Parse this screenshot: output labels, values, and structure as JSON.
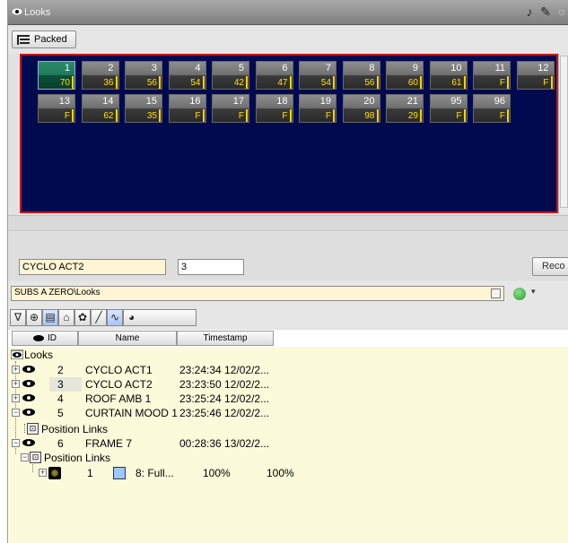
{
  "window": {
    "title": "Looks"
  },
  "toolbar": {
    "packed_label": "Packed"
  },
  "tiles": [
    {
      "num": "1",
      "val": "70",
      "selected": true
    },
    {
      "num": "2",
      "val": "36"
    },
    {
      "num": "3",
      "val": "56"
    },
    {
      "num": "4",
      "val": "54"
    },
    {
      "num": "5",
      "val": "42"
    },
    {
      "num": "6",
      "val": "47"
    },
    {
      "num": "7",
      "val": "54"
    },
    {
      "num": "8",
      "val": "56"
    },
    {
      "num": "9",
      "val": "60"
    },
    {
      "num": "10",
      "val": "61"
    },
    {
      "num": "11",
      "val": "F"
    },
    {
      "num": "12",
      "val": "F"
    },
    {
      "num": "13",
      "val": "F"
    },
    {
      "num": "14",
      "val": "62"
    },
    {
      "num": "15",
      "val": "35"
    },
    {
      "num": "16",
      "val": "F"
    },
    {
      "num": "17",
      "val": "F"
    },
    {
      "num": "18",
      "val": "F"
    },
    {
      "num": "19",
      "val": "F"
    },
    {
      "num": "20",
      "val": "98"
    },
    {
      "num": "21",
      "val": "29"
    },
    {
      "num": "95",
      "val": "F"
    },
    {
      "num": "96",
      "val": "F"
    }
  ],
  "editor": {
    "name_value": "CYCLO ACT2",
    "number_value": "3",
    "record_label": "Reco"
  },
  "path": {
    "value": "SUBS A ZERO\\Looks"
  },
  "columns": {
    "id": "ID",
    "name": "Name",
    "timestamp": "Timestamp"
  },
  "tree": {
    "root": "Looks",
    "items": [
      {
        "id": "2",
        "name": "CYCLO ACT1",
        "timestamp": "23:24:34 12/02/2..."
      },
      {
        "id": "3",
        "name": "CYCLO ACT2",
        "timestamp": "23:23:50 12/02/2..."
      },
      {
        "id": "4",
        "name": "ROOF AMB 1",
        "timestamp": "23:25:24 12/02/2..."
      },
      {
        "id": "5",
        "name": "CURTAIN MOOD 1",
        "timestamp": "23:25:46 12/02/2..."
      },
      {
        "id": "6",
        "name": "FRAME 7",
        "timestamp": "00:28:36 13/02/2..."
      }
    ],
    "position_links": "Position Links",
    "sub": {
      "num": "1",
      "label": "8: Full...",
      "v1": "100%",
      "v2": "100%"
    }
  },
  "colors": {
    "grid_bg": "#020a4f",
    "grid_border": "#c81818",
    "tree_bg": "#fbfbdb",
    "value_yellow": "#ffe000",
    "selected_tile": "#1f7a5a"
  }
}
